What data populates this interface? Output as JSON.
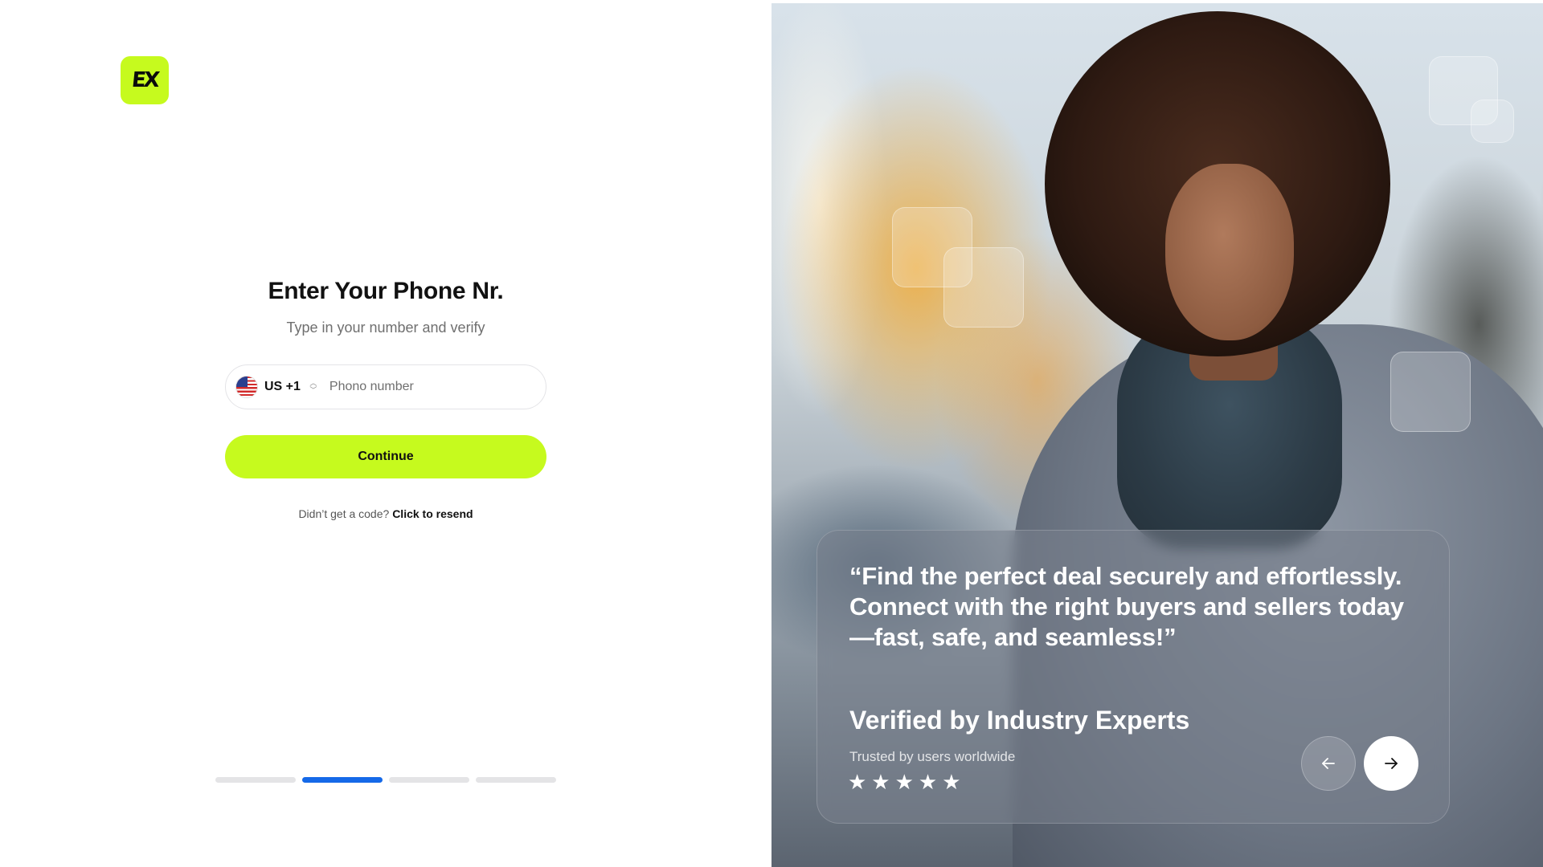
{
  "brand": {
    "logo_text": "EX",
    "accent_color": "#c6fa1e"
  },
  "form": {
    "title": "Enter Your Phone Nr.",
    "subtitle": "Type in your number and verify",
    "country_code": "US +1",
    "phone_placeholder": "Phono number",
    "phone_value": "",
    "continue_label": "Continue",
    "resend_prompt": "Didn’t get a code?",
    "resend_link": "Click to resend"
  },
  "progress": {
    "steps": 4,
    "active_step": 2,
    "active_color": "#1569e8"
  },
  "testimonial": {
    "quote": "“Find the perfect deal securely and effortlessly. Connect with the right buyers and sellers today—fast, safe, and seamless!”",
    "heading": "Verified by Industry Experts",
    "subheading": "Trusted by users worldwide",
    "rating": 5,
    "stars": "★★★★★"
  },
  "icons": {
    "flag": "us-flag-icon",
    "country_chevron": "chevron-up-down-icon",
    "prev": "arrow-left-icon",
    "next": "arrow-right-icon"
  }
}
